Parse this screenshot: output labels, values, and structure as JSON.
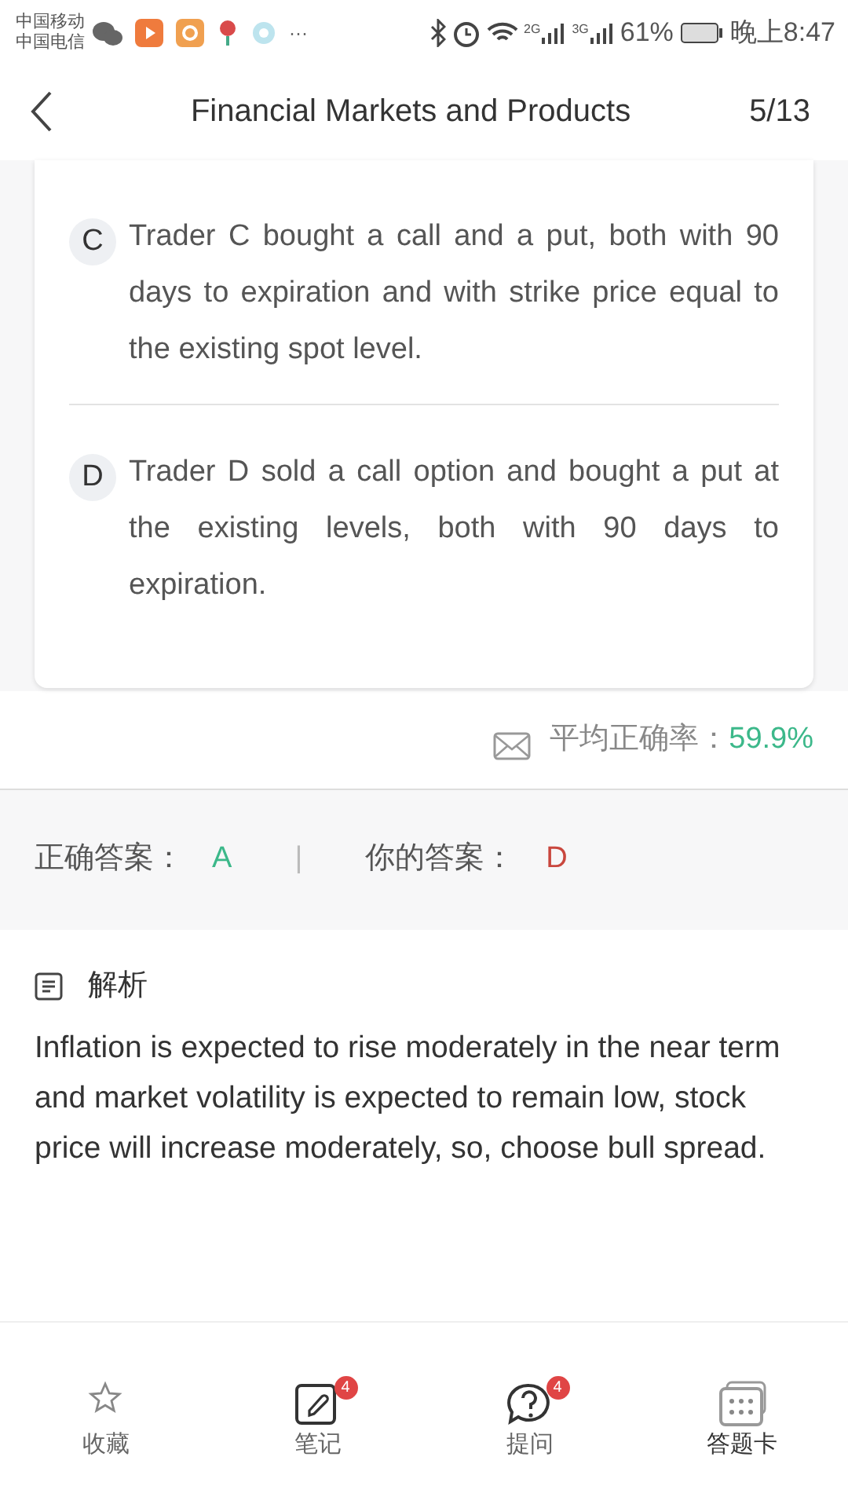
{
  "status_bar": {
    "carriers": [
      "中国移动",
      "中国电信"
    ],
    "more": "···",
    "net_1": "2G",
    "net_2": "3G",
    "battery": "61%",
    "time": "晚上8:47"
  },
  "header": {
    "title": "Financial Markets and Products",
    "progress": "5/13"
  },
  "options": [
    {
      "letter": "C",
      "text": "Trader C bought a call and a put, both with 90 days to expiration and with strike price equal to the existing spot level."
    },
    {
      "letter": "D",
      "text": "Trader D sold a call option and bought a put at the existing levels, both with 90 days to expiration."
    }
  ],
  "accuracy": {
    "label": "平均正确率：",
    "value": "59.9%"
  },
  "answers": {
    "correct_label": "正确答案：",
    "correct": "A",
    "divider": "|",
    "yours_label": "你的答案：",
    "yours": "D"
  },
  "analysis": {
    "title": "解析",
    "text": "Inflation is expected to rise moderately in the near term and market volatility is expected to remain low, stock price will increase moderately, so, choose bull spread."
  },
  "bottom_nav": [
    {
      "kind": "star",
      "label": "收藏",
      "active": false
    },
    {
      "kind": "note",
      "label": "笔记",
      "badge": "4",
      "active": false
    },
    {
      "kind": "question",
      "label": "提问",
      "badge": "4",
      "active": false
    },
    {
      "kind": "card",
      "label": "答题卡",
      "active": true
    }
  ]
}
